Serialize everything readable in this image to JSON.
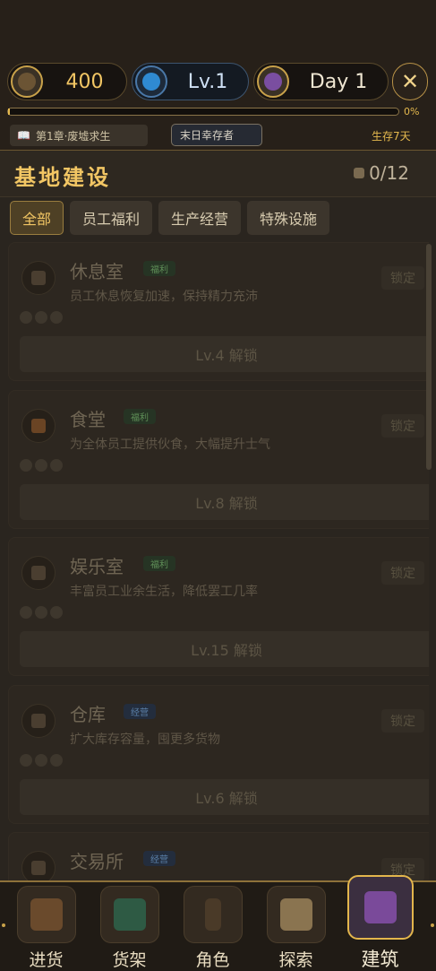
{
  "stats": {
    "gold": "400",
    "level": "Lv.1",
    "day": "Day 1",
    "close_symbol": "✕",
    "progress_percent": 0,
    "progress_label": "0%"
  },
  "info": {
    "chapter_icon": "📖",
    "chapter": "第1章·废墟求生",
    "status": "末日幸存者",
    "survive": "生存7天"
  },
  "header": {
    "title": "基地建设",
    "count": "0/12"
  },
  "tabs": [
    {
      "label": "全部",
      "active": true
    },
    {
      "label": "员工福利",
      "active": false
    },
    {
      "label": "生产经营",
      "active": false
    },
    {
      "label": "特殊设施",
      "active": false
    }
  ],
  "buildings": [
    {
      "name": "休息室",
      "tag": "福利",
      "tag_type": "welfare",
      "desc": "员工休息恢复加速，保持精力充沛",
      "lock": "锁定",
      "unlock": "Lv.4 解锁"
    },
    {
      "name": "食堂",
      "tag": "福利",
      "tag_type": "welfare",
      "desc": "为全体员工提供伙食，大幅提升士气",
      "lock": "锁定",
      "unlock": "Lv.8 解锁"
    },
    {
      "name": "娱乐室",
      "tag": "福利",
      "tag_type": "welfare",
      "desc": "丰富员工业余生活，降低罢工几率",
      "lock": "锁定",
      "unlock": "Lv.15 解锁"
    },
    {
      "name": "仓库",
      "tag": "经营",
      "tag_type": "business",
      "desc": "扩大库存容量，囤更多货物",
      "lock": "锁定",
      "unlock": "Lv.6 解锁"
    },
    {
      "name": "交易所",
      "tag": "经营",
      "tag_type": "business",
      "desc": "",
      "lock": "锁定",
      "unlock": ""
    }
  ],
  "nav": [
    {
      "label": "进货",
      "icon": "cart-icon",
      "active": false
    },
    {
      "label": "货架",
      "icon": "shelf-icon",
      "active": false
    },
    {
      "label": "角色",
      "icon": "character-icon",
      "active": false
    },
    {
      "label": "探索",
      "icon": "map-icon",
      "active": false
    },
    {
      "label": "建筑",
      "icon": "building-icon",
      "active": true
    }
  ],
  "colors": {
    "accent_gold": "#f2c664",
    "welfare_tag": "#5f8f58",
    "business_tag": "#5a7fa8",
    "background": "#2a251f"
  }
}
